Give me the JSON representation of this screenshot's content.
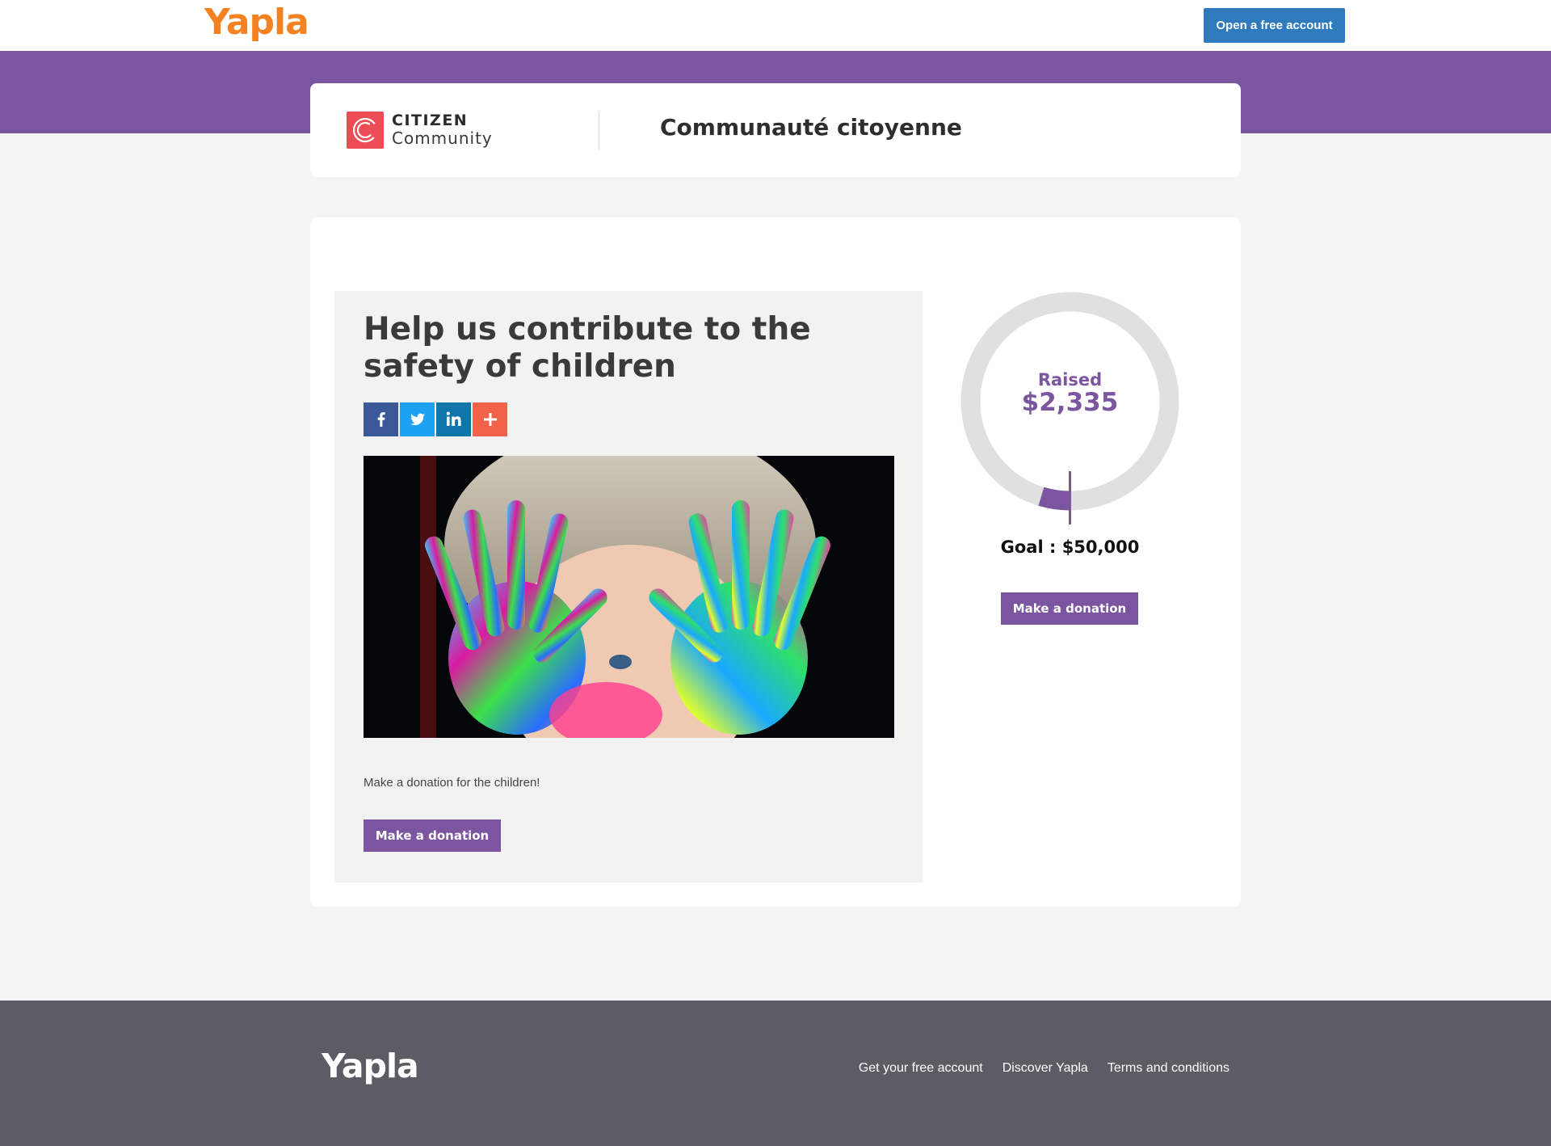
{
  "header": {
    "brand": "Yapla",
    "open_account_label": "Open a free account",
    "brand_color": "#f58220",
    "button_color": "#2f7bbd"
  },
  "organization": {
    "logo_icon": "citizen-c-icon",
    "logo_line1": "CITIZEN",
    "logo_line2": "Community",
    "logo_color": "#ec4d54",
    "name": "Communauté citoyenne",
    "band_color": "#7b559f"
  },
  "campaign": {
    "title": "Help us contribute to the safety of children",
    "share_buttons": [
      {
        "icon": "facebook-icon",
        "color": "#3b5998"
      },
      {
        "icon": "twitter-icon",
        "color": "#1da1f2"
      },
      {
        "icon": "linkedin-icon",
        "color": "#0e76a8"
      },
      {
        "icon": "plus-icon",
        "color": "#f2624b"
      }
    ],
    "hero_image": "child-with-painted-hands",
    "description": "Make a donation for the children!",
    "donate_label": "Make a donation"
  },
  "progress": {
    "raised_label": "Raised",
    "raised_amount": "$2,335",
    "goal_text": "Goal : $50,000",
    "raised_fraction": 0.0467,
    "donate_label": "Make a donation",
    "accent_color": "#7b559f"
  },
  "footer": {
    "brand": "Yapla",
    "links": [
      "Get your free account",
      "Discover Yapla",
      "Terms and conditions"
    ],
    "background_color": "#5a5d63"
  }
}
